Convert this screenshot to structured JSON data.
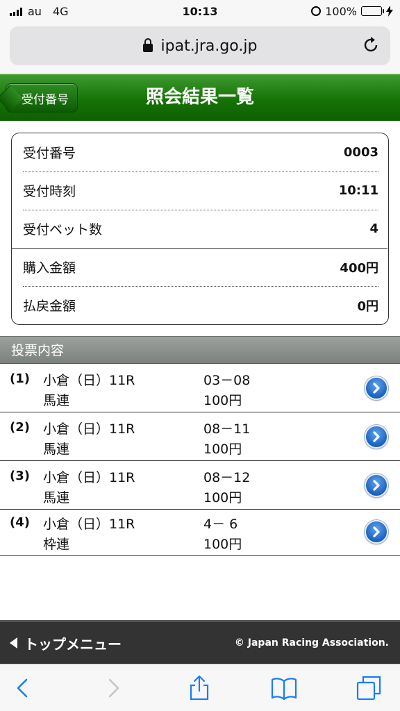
{
  "status_bar": {
    "carrier": "au",
    "network": "4G",
    "time": "10:13",
    "battery": "100%",
    "battery_color": "#4cd964"
  },
  "browser": {
    "url": "ipat.jra.go.jp",
    "icons": [
      "lock-icon",
      "reload-icon"
    ]
  },
  "header": {
    "back_label": "受付番号",
    "title": "照会結果一覧",
    "color": "#167306"
  },
  "receipt": {
    "rows": [
      {
        "label": "受付番号",
        "value": "0003"
      },
      {
        "label": "受付時刻",
        "value": "10:11"
      },
      {
        "label": "受付ベット数",
        "value": "4"
      },
      {
        "label": "購入金額",
        "value": "400円"
      },
      {
        "label": "払戻金額",
        "value": "0円"
      }
    ]
  },
  "section": {
    "title": "投票内容"
  },
  "bets": [
    {
      "num": "(1)",
      "race": "小倉（日）11R",
      "type": "馬連",
      "combo": "03－08",
      "amount": "100円"
    },
    {
      "num": "(2)",
      "race": "小倉（日）11R",
      "type": "馬連",
      "combo": "08－11",
      "amount": "100円"
    },
    {
      "num": "(3)",
      "race": "小倉（日）11R",
      "type": "馬連",
      "combo": "08－12",
      "amount": "100円"
    },
    {
      "num": "(4)",
      "race": "小倉（日）11R",
      "type": "枠連",
      "combo": "4－ 6",
      "amount": "100円"
    }
  ],
  "footer": {
    "top_menu": "トップメニュー",
    "copyright": "© Japan Racing Association."
  },
  "toolbar": {
    "icons": [
      "back-icon",
      "forward-icon",
      "share-icon",
      "bookmarks-icon",
      "tabs-icon"
    ],
    "accent": "#1a7cf5"
  }
}
